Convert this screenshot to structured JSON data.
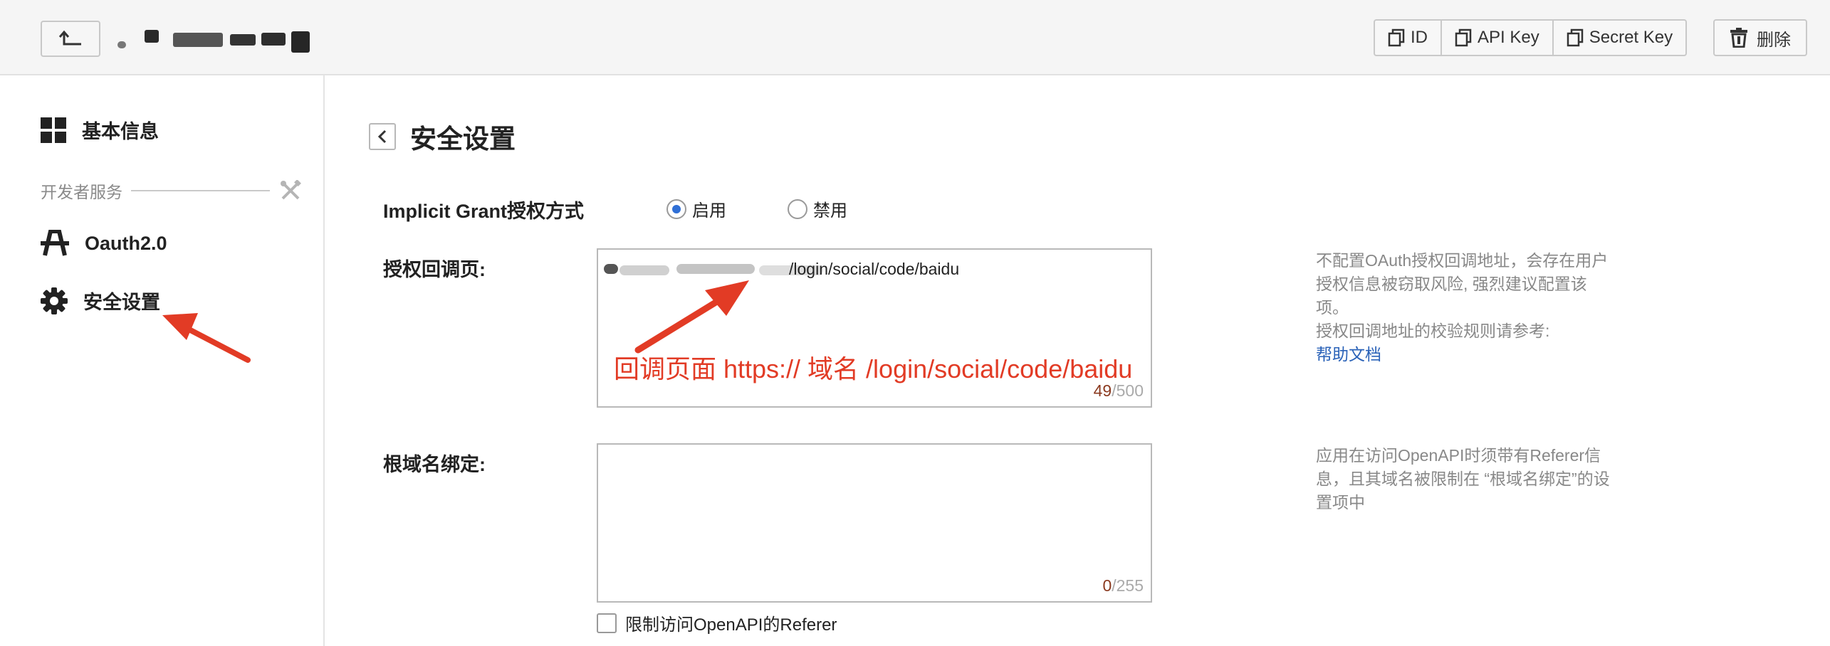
{
  "header": {
    "id_label": "ID",
    "api_key_label": "API Key",
    "secret_key_label": "Secret Key",
    "delete_label": "删除"
  },
  "sidebar": {
    "basic_info": "基本信息",
    "section_label": "开发者服务",
    "oauth": "Oauth2.0",
    "security": "安全设置"
  },
  "main": {
    "title": "安全设置",
    "implicit_grant": {
      "label": "Implicit Grant授权方式",
      "enable": "启用",
      "disable": "禁用",
      "selected": "启用"
    },
    "callback": {
      "label": "授权回调页:",
      "value_visible": "/login/social/code/baidu",
      "count": "49",
      "max": "/500",
      "hint_1": "不配置OAuth授权回调地址，会存在用户授权信息被窃取风险, 强烈建议配置该项。",
      "hint_2": "授权回调地址的校验规则请参考:",
      "help_link": "帮助文档",
      "annotation": "回调页面 https:// 域名 /login/social/code/baidu"
    },
    "root_domain": {
      "label": "根域名绑定:",
      "count": "0",
      "max": "/255",
      "hint": "应用在访问OpenAPI时须带有Referer信息，且其域名被限制在 “根域名绑定”的设置项中"
    },
    "referer_checkbox": "限制访问OpenAPI的Referer"
  },
  "colors": {
    "annotation": "#e23b25",
    "link": "#2a62b8",
    "radio_accent": "#2f6fd6"
  }
}
